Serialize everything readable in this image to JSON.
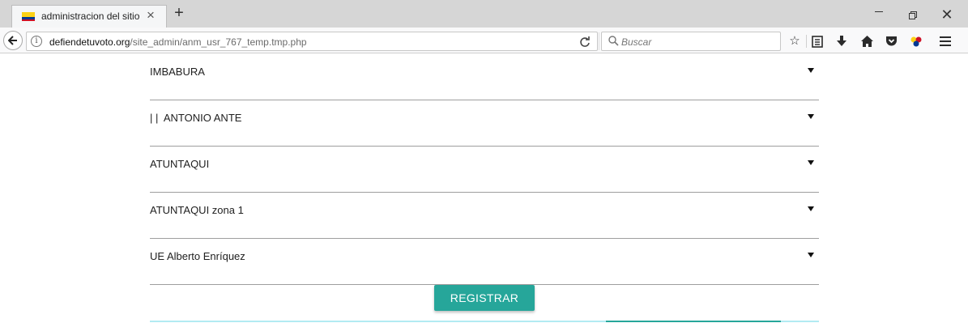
{
  "browser": {
    "tab": {
      "title": "administracion del sitio",
      "close": "×"
    },
    "new_tab": "+",
    "window": {
      "minimize": "—",
      "close": "✕"
    },
    "url": {
      "domain": "defiendetuvoto.org",
      "path": "/site_admin/anm_usr_767_temp.tmp.php"
    },
    "search": {
      "placeholder": "Buscar"
    },
    "colors": {
      "flag_yellow": "#fcd116",
      "flag_blue": "#003893",
      "flag_red": "#ce1126"
    }
  },
  "form": {
    "selects": [
      {
        "value": "IMBABURA"
      },
      {
        "value": "| |  ANTONIO ANTE"
      },
      {
        "value": "ATUNTAQUI"
      },
      {
        "value": "ATUNTAQUI zona 1"
      },
      {
        "value": "UE Alberto Enríquez"
      }
    ],
    "register_label": "REGISTRAR",
    "accent_color": "#26a69a"
  }
}
